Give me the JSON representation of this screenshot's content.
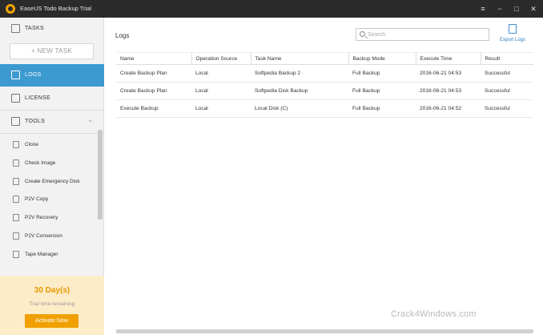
{
  "window": {
    "title": "EaseUS Todo Backup Trial",
    "controls": {
      "menu": "≡",
      "minimize": "−",
      "maximize": "□",
      "close": "✕"
    }
  },
  "sidebar": {
    "tasks_label": "TASKS",
    "new_task_label": "+ NEW TASK",
    "logs_label": "LOGS",
    "license_label": "LICENSE",
    "tools_label": "TOOLS",
    "tools_chevron": "⌄",
    "tools": [
      {
        "label": "Clone",
        "icon": "clone-icon"
      },
      {
        "label": "Check Image",
        "icon": "check-image-icon"
      },
      {
        "label": "Create Emergency Disk",
        "icon": "emergency-disk-icon"
      },
      {
        "label": "P2V Copy",
        "icon": "p2v-copy-icon"
      },
      {
        "label": "P2V Recovery",
        "icon": "p2v-recovery-icon"
      },
      {
        "label": "P2V Conversion",
        "icon": "p2v-conversion-icon"
      },
      {
        "label": "Tape Manager",
        "icon": "tape-manager-icon"
      }
    ]
  },
  "trial": {
    "days": "30 Day(s)",
    "remaining": "Trial time remaining",
    "activate_label": "Activate Now"
  },
  "main": {
    "title": "Logs",
    "search_placeholder": "Search",
    "export_label": "Export Logs",
    "columns": [
      "Name",
      "Operation Source",
      "Task Name",
      "Backup Mode",
      "Execute Time",
      "Result"
    ],
    "rows": [
      [
        "Create Backup Plan",
        "Local",
        "Softpedia Backup 2",
        "Full Backup",
        "2016-06-21 04:53",
        "Successful"
      ],
      [
        "Create Backup Plan",
        "Local",
        "Softpedia Disk Backup",
        "Full Backup",
        "2016-06-21 04:53",
        "Successful"
      ],
      [
        "Execute Backup",
        "Local",
        "Local Disk (C)",
        "Full Backup",
        "2016-06-21 04:52",
        "Successful"
      ]
    ]
  },
  "watermark": "Crack4Windows.com",
  "colors": {
    "titlebar": "#2b2b2b",
    "accent": "#3d9ad1",
    "trial_bg": "#fdecc8",
    "activate": "#f0a000"
  }
}
